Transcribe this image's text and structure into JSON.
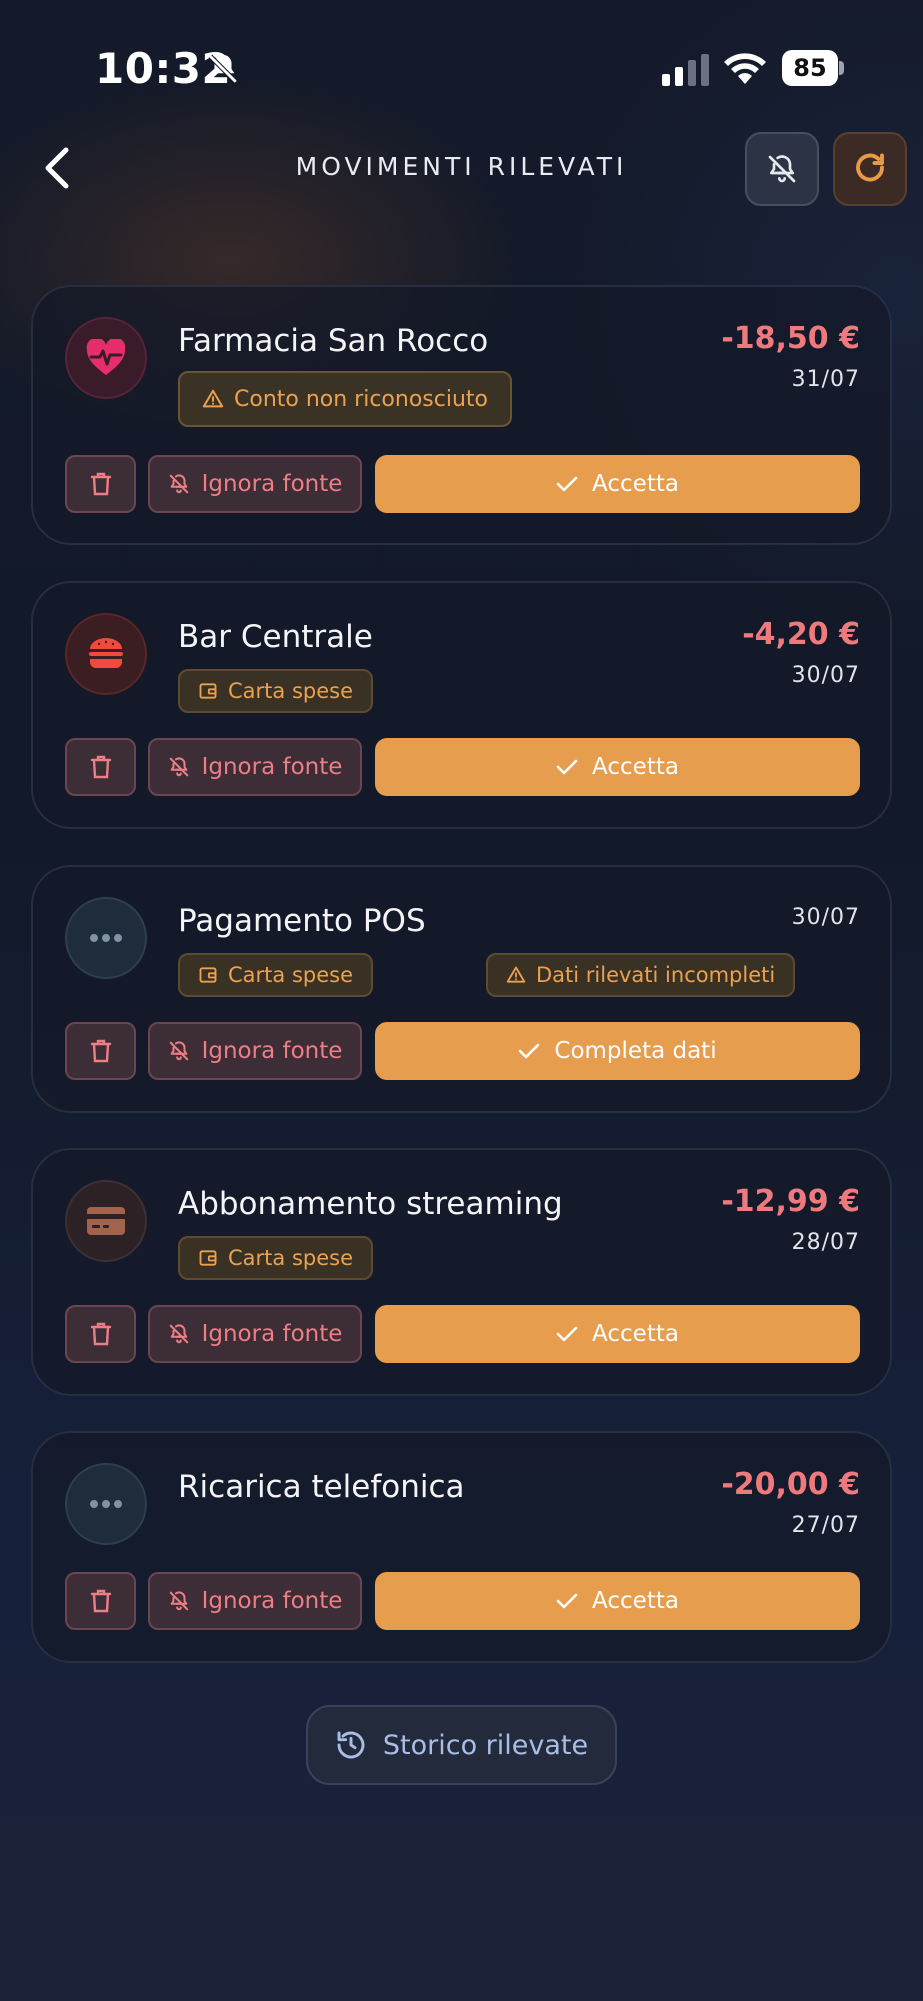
{
  "status_bar": {
    "time": "10:32",
    "battery": "85"
  },
  "header": {
    "title": "MOVIMENTI RILEVATI"
  },
  "colors": {
    "accent": "#e69d4d",
    "negative": "#ef7a7e",
    "danger_bg": "#3c2d36",
    "background": "#141a29"
  },
  "cards": [
    {
      "name": "Farmacia San Rocco",
      "amount": "-18,50 €",
      "date": "31/07",
      "icon": "heart-pulse-icon",
      "tags": [
        {
          "label": "Conto non riconosciuto",
          "icon": "warning-icon"
        }
      ],
      "actions": {
        "ignore": "Ignora fonte",
        "primary": "Accetta"
      }
    },
    {
      "name": "Bar Centrale",
      "amount": "-4,20 €",
      "date": "30/07",
      "icon": "burger-icon",
      "tags": [
        {
          "label": "Carta spese",
          "icon": "wallet-icon"
        }
      ],
      "actions": {
        "ignore": "Ignora fonte",
        "primary": "Accetta"
      }
    },
    {
      "name": "Pagamento POS",
      "amount": "",
      "date": "30/07",
      "icon": "more-dots-icon",
      "tags": [
        {
          "label": "Carta spese",
          "icon": "wallet-icon"
        },
        {
          "label": "Dati rilevati incompleti",
          "icon": "warning-icon"
        }
      ],
      "actions": {
        "ignore": "Ignora fonte",
        "primary": "Completa dati"
      }
    },
    {
      "name": "Abbonamento streaming",
      "amount": "-12,99 €",
      "date": "28/07",
      "icon": "credit-card-icon",
      "tags": [
        {
          "label": "Carta spese",
          "icon": "wallet-icon"
        }
      ],
      "actions": {
        "ignore": "Ignora fonte",
        "primary": "Accetta"
      }
    },
    {
      "name": "Ricarica telefonica",
      "amount": "-20,00 €",
      "date": "27/07",
      "icon": "more-dots-icon",
      "tags": [],
      "actions": {
        "ignore": "Ignora fonte",
        "primary": "Accetta"
      }
    }
  ],
  "footer": {
    "history_label": "Storico rilevate"
  }
}
